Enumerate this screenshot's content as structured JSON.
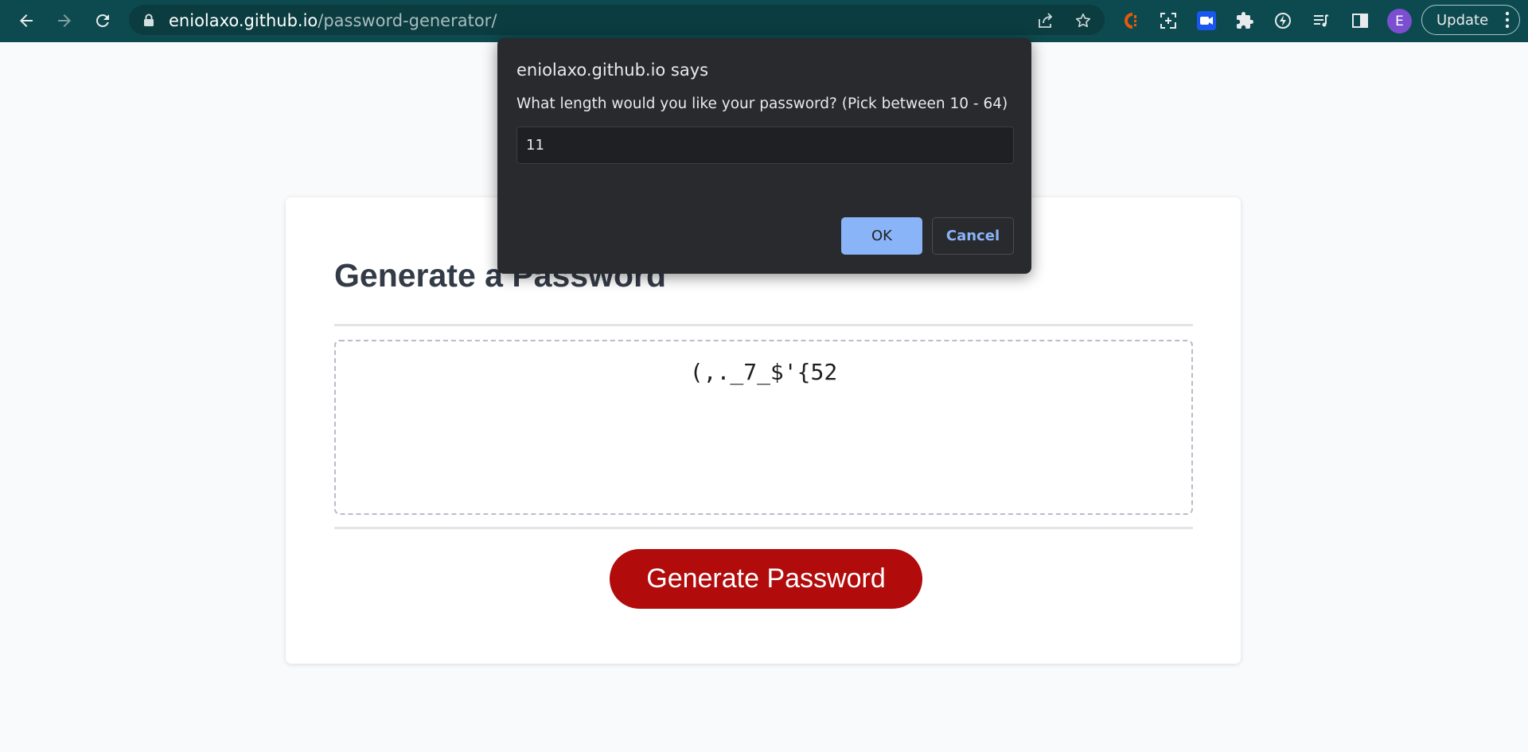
{
  "browser": {
    "url_host": "eniolaxo.github.io",
    "url_path": "/password-generator/",
    "profile_initial": "E",
    "update_label": "Update",
    "colors": {
      "toolbar": "#0d4a4f",
      "omnibox": "#0a3c40"
    },
    "icons": [
      "back-icon",
      "forward-icon",
      "reload-icon",
      "lock-icon",
      "share-icon",
      "star-icon",
      "extension-c-icon",
      "screenshot-icon",
      "video-icon",
      "puzzle-icon",
      "speed-icon",
      "media-icon",
      "side-panel-icon",
      "more-vert-icon"
    ]
  },
  "page": {
    "title": "Generate a Password",
    "password": "(,._7_$'{52",
    "generate_button": "Generate Password",
    "colors": {
      "accent": "#b10b0b",
      "title": "#333b47"
    }
  },
  "dialog": {
    "title": "eniolaxo.github.io says",
    "message": "What length would you like your password? (Pick between 10 - 64)",
    "input_value": "11",
    "ok_label": "OK",
    "cancel_label": "Cancel",
    "colors": {
      "background": "#292a2d",
      "ok": "#8ab4f8"
    }
  }
}
